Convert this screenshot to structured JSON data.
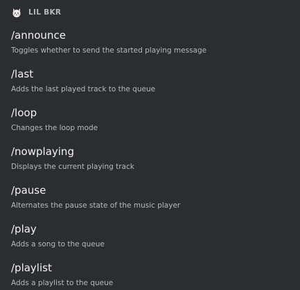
{
  "header": {
    "bot_name": "LIL BKR",
    "avatar_icon": "cat-face-icon"
  },
  "colors": {
    "background": "#2b2d31",
    "command_name": "#f2f3f5",
    "command_description": "#b5bac1"
  },
  "commands": [
    {
      "name": "/announce",
      "description": "Toggles whether to send the started playing message"
    },
    {
      "name": "/last",
      "description": "Adds the last played track to the queue"
    },
    {
      "name": "/loop",
      "description": "Changes the loop mode"
    },
    {
      "name": "/nowplaying",
      "description": "Displays the current playing track"
    },
    {
      "name": "/pause",
      "description": "Alternates the pause state of the music player"
    },
    {
      "name": "/play",
      "description": "Adds a song to the queue"
    },
    {
      "name": "/playlist",
      "description": "Adds a playlist to the queue"
    }
  ]
}
